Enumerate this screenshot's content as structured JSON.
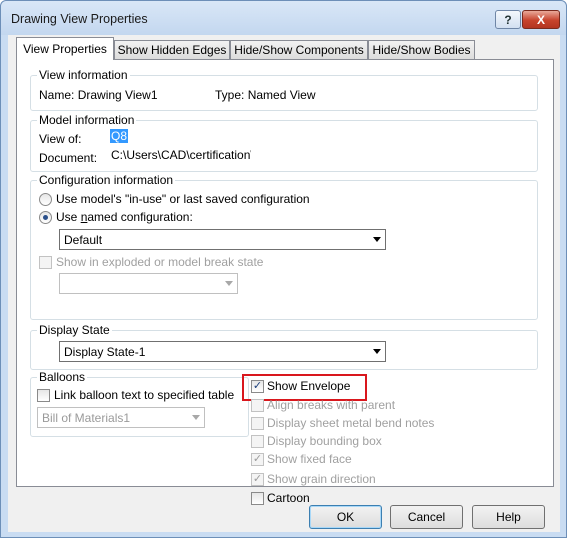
{
  "window": {
    "title": "Drawing View Properties",
    "help_btn": "?",
    "close_btn": "X"
  },
  "tabs": [
    {
      "label": "View Properties"
    },
    {
      "label": "Show Hidden Edges"
    },
    {
      "label": "Hide/Show Components"
    },
    {
      "label": "Hide/Show Bodies"
    }
  ],
  "view_info": {
    "title": "View information",
    "name_label": "Name:",
    "name_value": "Drawing View1",
    "type_label": "Type:",
    "type_value": "Named View"
  },
  "model_info": {
    "title": "Model information",
    "view_of_label": "View of:",
    "view_of_value": "Q8",
    "document_label": "Document:",
    "document_value": "C:\\Users\\CAD\\certification\\cs\\"
  },
  "config_info": {
    "title": "Configuration information",
    "option_inuse": "Use model's \"in-use\" or last saved configuration",
    "option_named_prefix": "Use ",
    "option_named_u": "n",
    "option_named_suffix": "amed configuration:",
    "named_value": "Default",
    "exploded_label": "Show in exploded or model break state",
    "exploded_combo": ""
  },
  "display_state": {
    "title": "Display State",
    "value": "Display State-1"
  },
  "balloons": {
    "title": "Balloons",
    "link_label": "Link balloon text to specified table",
    "table_value": "Bill of Materials1"
  },
  "options": {
    "show_envelope": "Show Envelope",
    "align_breaks": "Align breaks with parent",
    "sheet_metal": "Display sheet metal bend notes",
    "bounding_box": "Display bounding box",
    "fixed_face": "Show fixed face",
    "grain_direction": "Show grain direction",
    "cartoon": "Cartoon"
  },
  "buttons": {
    "ok": "OK",
    "cancel": "Cancel",
    "help": "Help"
  },
  "colors": {
    "highlight": "#d9171d",
    "selection": "#3399ff"
  }
}
